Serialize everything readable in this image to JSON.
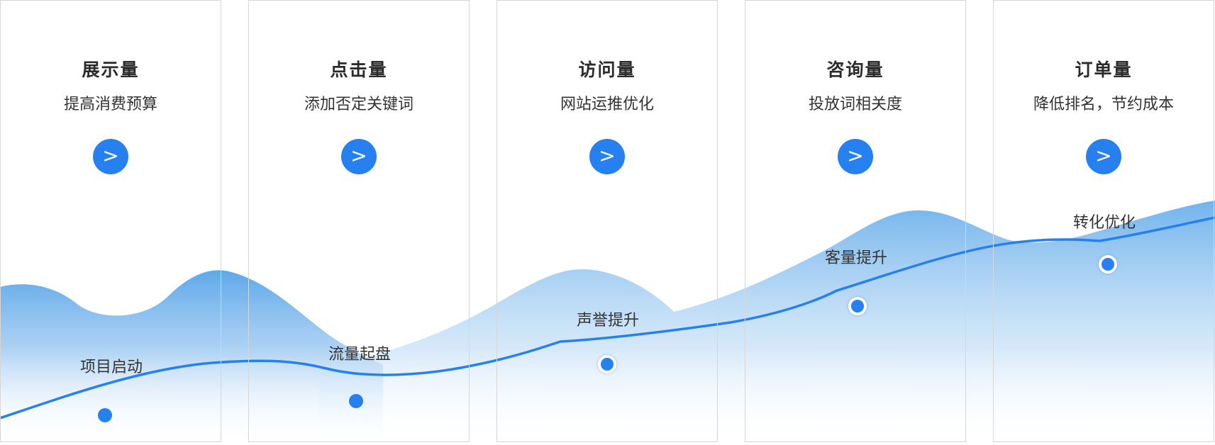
{
  "colors": {
    "accent": "#2680f0",
    "wave_top": "#6aaee9",
    "wave_bottom": "#ffffff",
    "border": "#d6d6d6",
    "text": "#333333"
  },
  "cards": [
    {
      "title": "展示量",
      "subtitle": "提高消费预算",
      "button_icon": ">"
    },
    {
      "title": "点击量",
      "subtitle": "添加否定关键词",
      "button_icon": ">"
    },
    {
      "title": "访问量",
      "subtitle": "网站运推优化",
      "button_icon": ">"
    },
    {
      "title": "咨询量",
      "subtitle": "投放词相关度",
      "button_icon": ">"
    },
    {
      "title": "订单量",
      "subtitle": "降低排名，节约成本",
      "button_icon": ">"
    }
  ],
  "milestones": [
    {
      "label": "项目启动"
    },
    {
      "label": "流量起盘"
    },
    {
      "label": "声誉提升"
    },
    {
      "label": "客量提升"
    },
    {
      "label": "转化优化"
    }
  ]
}
